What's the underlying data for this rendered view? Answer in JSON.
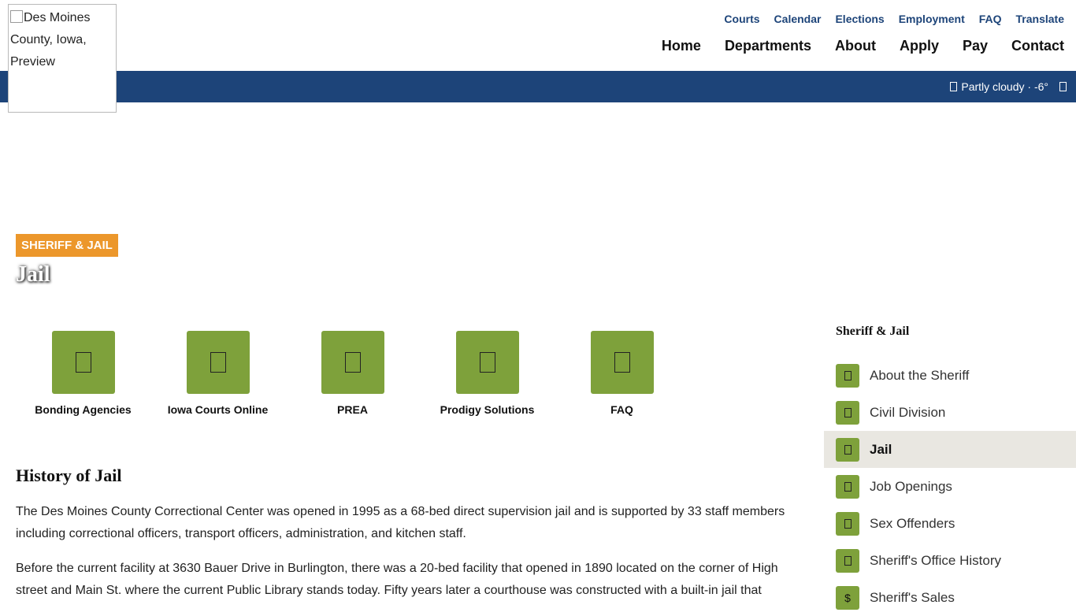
{
  "logo": {
    "alt_text": "Des Moines County, Iowa, Preview"
  },
  "top_links": [
    "Courts",
    "Calendar",
    "Elections",
    "Employment",
    "FAQ",
    "Translate"
  ],
  "main_nav": [
    "Home",
    "Departments",
    "About",
    "Apply",
    "Pay",
    "Contact"
  ],
  "weather": {
    "text": "Partly cloudy · -6°",
    "icon": "weather-icon"
  },
  "section_badge": "SHERIFF & JAIL",
  "page_title": "Jail",
  "quick_links": [
    {
      "label": "Bonding Agencies",
      "icon": "bonding-agencies-icon"
    },
    {
      "label": "Iowa Courts Online",
      "icon": "courts-online-icon"
    },
    {
      "label": "PREA",
      "icon": "prea-icon"
    },
    {
      "label": "Prodigy Solutions",
      "icon": "prodigy-solutions-icon"
    },
    {
      "label": "FAQ",
      "icon": "faq-icon"
    }
  ],
  "history": {
    "title": "History of Jail",
    "paragraphs": [
      "The Des Moines County Correctional Center was opened in 1995 as a 68-bed direct supervision jail and is supported by 33 staff members including correctional officers, transport officers, administration, and kitchen staff.",
      "Before the current facility at 3630 Bauer Drive in Burlington, there was a 20-bed facility that opened in 1890 located on the corner of High street and Main St. where the current Public Library stands today.  Fifty years later a courthouse was constructed with a built-in jail that"
    ]
  },
  "sidebar": {
    "title": "Sheriff & Jail",
    "items": [
      {
        "label": "About the Sheriff",
        "icon": "sheriff-icon",
        "active": false
      },
      {
        "label": "Civil Division",
        "icon": "civil-icon",
        "active": false
      },
      {
        "label": "Jail",
        "icon": "jail-icon",
        "active": true
      },
      {
        "label": "Job Openings",
        "icon": "jobs-icon",
        "active": false
      },
      {
        "label": "Sex Offenders",
        "icon": "offenders-icon",
        "active": false
      },
      {
        "label": "Sheriff's Office History",
        "icon": "history-icon",
        "active": false
      },
      {
        "label": "Sheriff's Sales",
        "icon": "dollar-icon",
        "glyph": "$",
        "active": false
      }
    ]
  }
}
